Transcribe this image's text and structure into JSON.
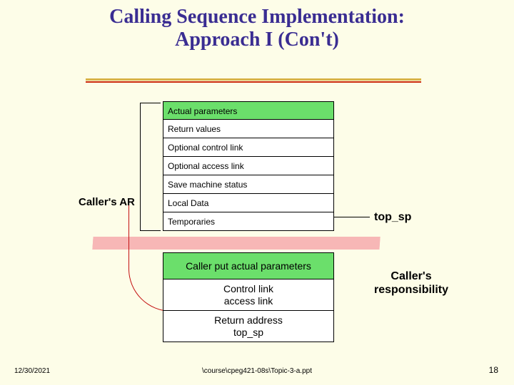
{
  "title_line1": "Calling Sequence Implementation:",
  "title_line2": "Approach I (Con't)",
  "stack1": {
    "r1": "Actual parameters",
    "r2": "Return values",
    "r3": "Optional control link",
    "r4": "Optional access link",
    "r5": "Save machine status",
    "r6": "Local Data",
    "r7": "Temporaries"
  },
  "stack2": {
    "r1": "Caller put actual parameters",
    "r2a": "Control link",
    "r2b": "access link",
    "r3a": "Return address",
    "r3b": "top_sp"
  },
  "labels": {
    "callers_ar": "Caller's AR",
    "top_sp": "top_sp",
    "callers_resp_1": "Caller's",
    "callers_resp_2": "responsibility"
  },
  "footer": {
    "date": "12/30/2021",
    "path": "\\course\\cpeg421-08s\\Topic-3-a.ppt",
    "page": "18"
  }
}
